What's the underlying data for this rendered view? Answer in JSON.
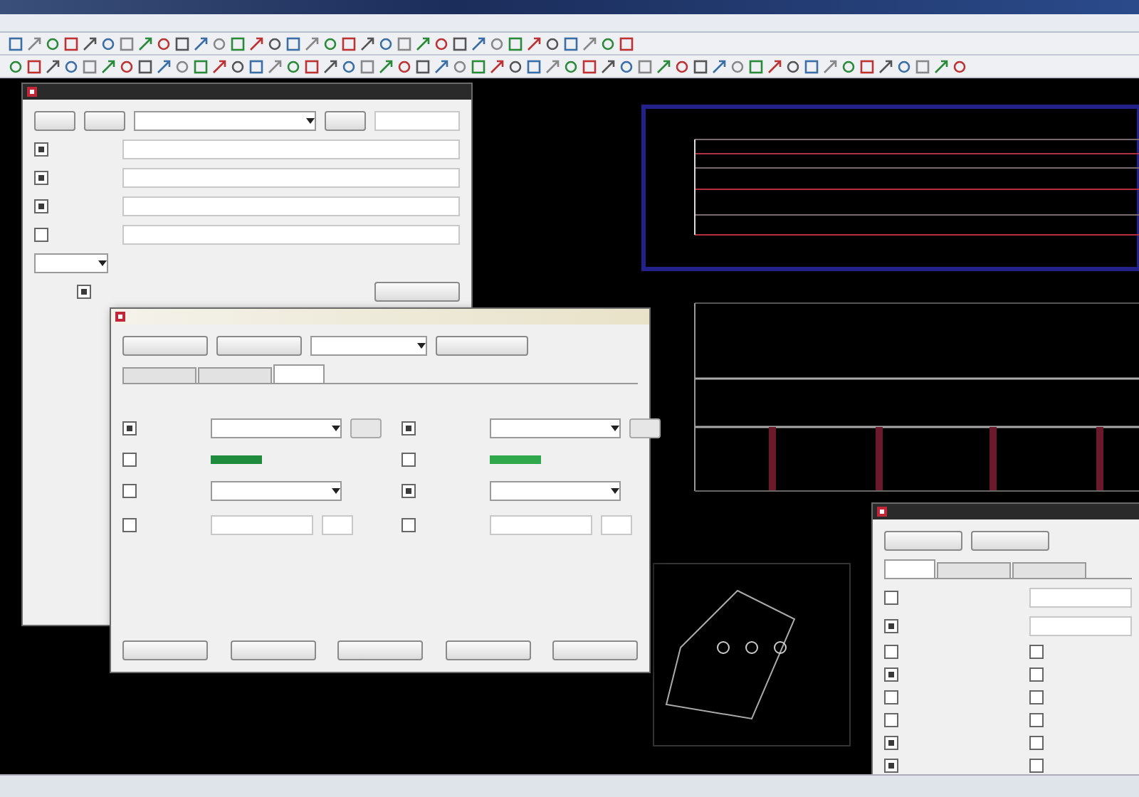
{
  "main_dialog": {
    "fields": [
      {
        "checked": true
      },
      {
        "checked": true
      },
      {
        "checked": true
      },
      {
        "checked": false
      }
    ],
    "option": {
      "checked": true
    }
  },
  "properties_dialog": {
    "tabs": [
      {
        "selected": false
      },
      {
        "selected": false
      },
      {
        "selected": true
      }
    ],
    "columns": [
      {
        "rows": [
          {
            "kind": "select",
            "checked": true
          },
          {
            "kind": "swatch",
            "checked": false,
            "color": "#1e8c3c"
          },
          {
            "kind": "select",
            "checked": false
          },
          {
            "kind": "plain",
            "checked": false
          }
        ]
      },
      {
        "rows": [
          {
            "kind": "select",
            "checked": true
          },
          {
            "kind": "swatch",
            "checked": false,
            "color": "#2ea84a"
          },
          {
            "kind": "select",
            "checked": true
          },
          {
            "kind": "plain",
            "checked": false
          }
        ]
      }
    ]
  },
  "layers_dialog": {
    "tabs": [
      {
        "selected": true
      },
      {
        "selected": false
      },
      {
        "selected": false
      }
    ],
    "rows": [
      {
        "kind": "field",
        "checked": false
      },
      {
        "kind": "field",
        "checked": true
      },
      {
        "kind": "toggle",
        "checked": false,
        "on": false
      },
      {
        "kind": "toggle",
        "checked": true,
        "on": false
      },
      {
        "kind": "toggle",
        "checked": false,
        "on": false
      },
      {
        "kind": "toggle",
        "checked": false,
        "on": false
      },
      {
        "kind": "toggle",
        "checked": true,
        "on": false
      },
      {
        "kind": "toggle",
        "checked": true,
        "on": false
      }
    ]
  }
}
